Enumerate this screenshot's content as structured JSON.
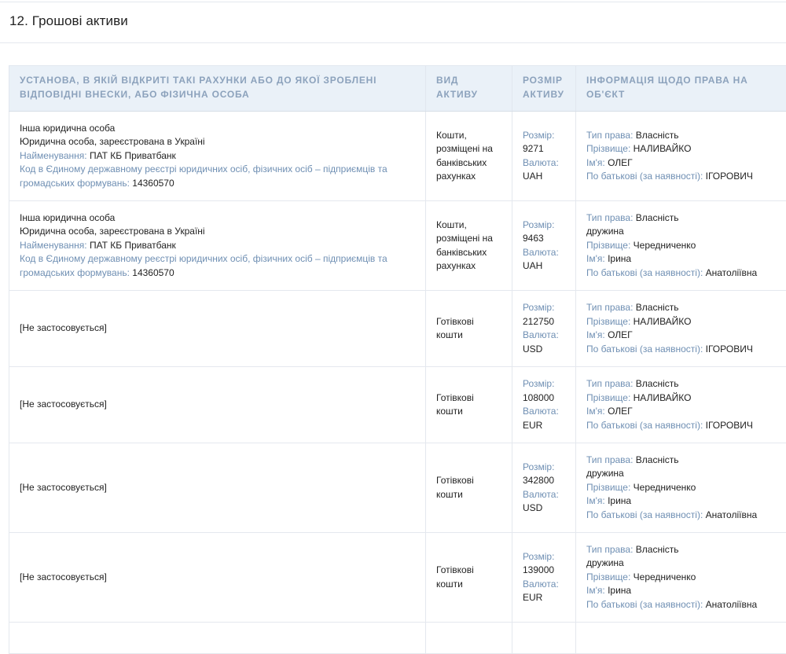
{
  "section": {
    "title": "12. Грошові активи"
  },
  "table": {
    "headers": [
      "Установа, в якій відкриті такі рахунки або до якої зроблені відповідні внески, або фізична особа",
      "Вид активу",
      "Розмір активу",
      "Інформація щодо права на об'єкт"
    ],
    "labels": {
      "name": "Найменування:",
      "code": "Код в Єдиному державному реєстрі юридичних осіб, фізичних осіб – підприємців та громадських формувань:",
      "size": "Розмір:",
      "currency": "Валюта:",
      "right_type": "Тип права:",
      "surname": "Прізвище:",
      "given_name": "Ім'я:",
      "patronymic": "По батькові (за наявності):"
    },
    "rows": [
      {
        "institution": {
          "line1": "Інша юридична особа",
          "line2": "Юридична особа, зареєстрована в Україні",
          "name": "ПАТ КБ Приватбанк",
          "code_a": "Код в Єдиному державному реєстрі юридичних осіб, фізичних осіб – підприємців та",
          "code_b": "громадських формувань:",
          "code": "14360570"
        },
        "asset_type": {
          "l1": "Кошти,",
          "l2": "розміщені на",
          "l3": "банківських",
          "l4": "рахунках"
        },
        "size": "9271",
        "currency": "UAH",
        "right": {
          "type": "Власність",
          "extra": "",
          "surname": "НАЛИВАЙКО",
          "given_name": "ОЛЕГ",
          "patronymic": "ІГОРОВИЧ"
        }
      },
      {
        "institution": {
          "line1": "Інша юридична особа",
          "line2": "Юридична особа, зареєстрована в Україні",
          "name": "ПАТ КБ Приватбанк",
          "code_a": "Код в Єдиному державному реєстрі юридичних осіб, фізичних осіб – підприємців та",
          "code_b": "громадських формувань:",
          "code": "14360570"
        },
        "asset_type": {
          "l1": "Кошти,",
          "l2": "розміщені на",
          "l3": "банківських",
          "l4": "рахунках"
        },
        "size": "9463",
        "currency": "UAH",
        "right": {
          "type": "Власність",
          "extra": "дружина",
          "surname": "Чередниченко",
          "given_name": "Ірина",
          "patronymic": "Анатоліївна"
        }
      },
      {
        "institution": {
          "not_applicable": "[Не застосовується]"
        },
        "asset_type": {
          "l1": "Готівкові",
          "l2": "кошти"
        },
        "size": "212750",
        "currency": "USD",
        "right": {
          "type": "Власність",
          "extra": "",
          "surname": "НАЛИВАЙКО",
          "given_name": "ОЛЕГ",
          "patronymic": "ІГОРОВИЧ"
        }
      },
      {
        "institution": {
          "not_applicable": "[Не застосовується]"
        },
        "asset_type": {
          "l1": "Готівкові",
          "l2": "кошти"
        },
        "size": "108000",
        "currency": "EUR",
        "right": {
          "type": "Власність",
          "extra": "",
          "surname": "НАЛИВАЙКО",
          "given_name": "ОЛЕГ",
          "patronymic": "ІГОРОВИЧ"
        }
      },
      {
        "institution": {
          "not_applicable": "[Не застосовується]"
        },
        "asset_type": {
          "l1": "Готівкові",
          "l2": "кошти"
        },
        "size": "342800",
        "currency": "USD",
        "right": {
          "type": "Власність",
          "extra": "дружина",
          "surname": "Чередниченко",
          "given_name": "Ірина",
          "patronymic": "Анатоліївна"
        }
      },
      {
        "institution": {
          "not_applicable": "[Не застосовується]"
        },
        "asset_type": {
          "l1": "Готівкові",
          "l2": "кошти"
        },
        "size": "139000",
        "currency": "EUR",
        "right": {
          "type": "Власність",
          "extra": "дружина",
          "surname": "Чередниченко",
          "given_name": "Ірина",
          "patronymic": "Анатоліївна"
        }
      }
    ]
  }
}
